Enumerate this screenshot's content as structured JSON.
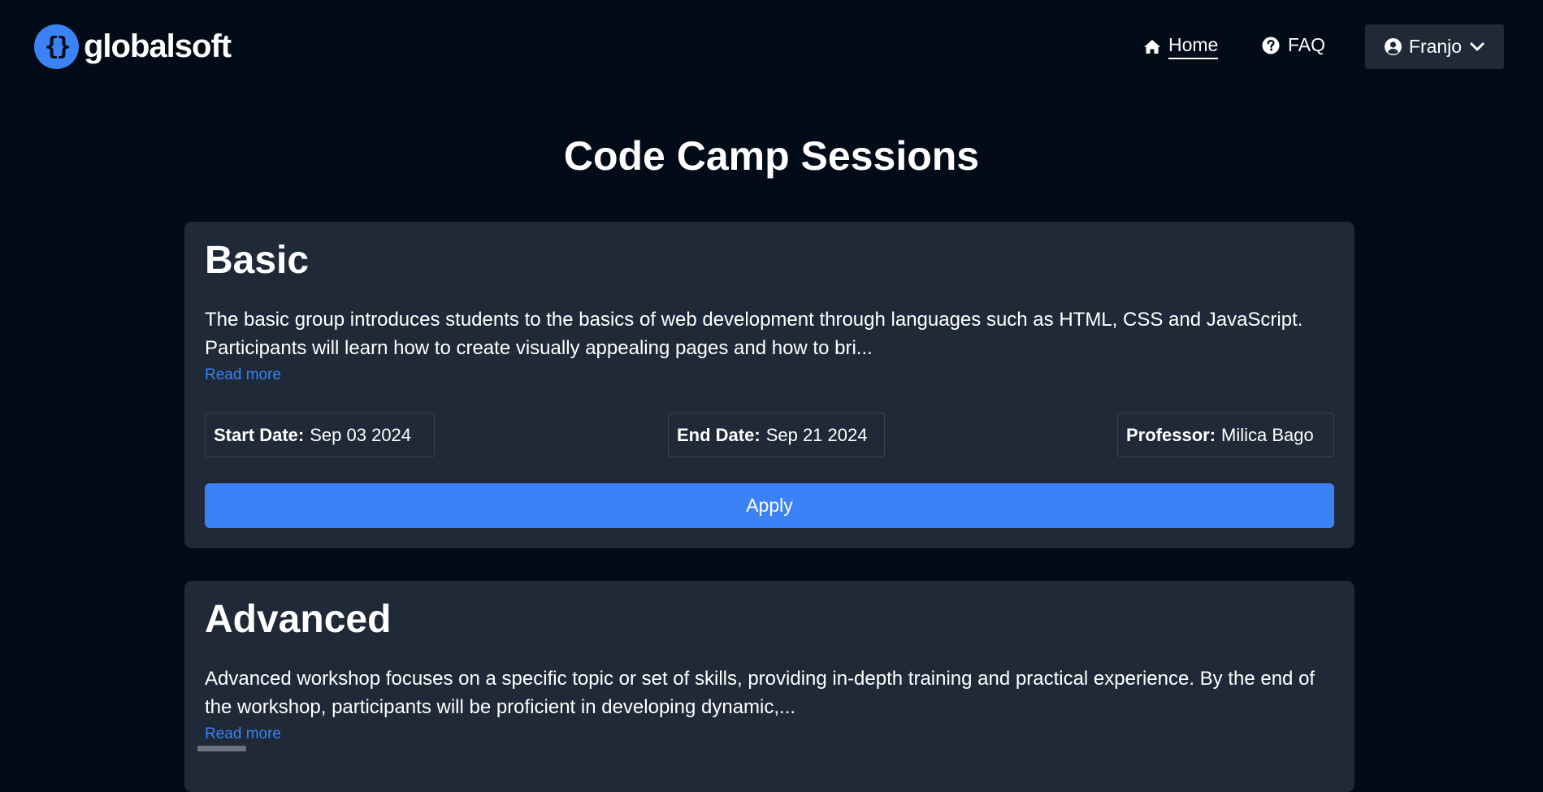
{
  "header": {
    "logo_mark": "{}",
    "logo_text": "globalsoft",
    "nav": {
      "home_label": "Home",
      "faq_label": "FAQ"
    },
    "user": {
      "name": "Franjo"
    }
  },
  "page": {
    "title": "Code Camp Sessions"
  },
  "sessions": [
    {
      "title": "Basic",
      "description": "The basic group introduces students to the basics of web development through languages such as HTML, CSS and JavaScript. Participants will learn how to create visually appealing pages and how to bri...",
      "read_more": "Read more",
      "start_label": "Start Date:",
      "start_value": "Sep 03 2024",
      "end_label": "End Date:",
      "end_value": "Sep 21 2024",
      "professor_label": "Professor:",
      "professor_value": "Milica Bago",
      "apply_label": "Apply"
    },
    {
      "title": "Advanced",
      "description": "Advanced workshop focuses on a specific topic or set of skills, providing in-depth training and practical experience. By the end of the workshop, participants will be proficient in developing dynamic,...",
      "read_more": "Read more"
    }
  ],
  "colors": {
    "background": "#020c18",
    "card": "#1f2937",
    "accent": "#3b82f6"
  },
  "icons": {
    "home": "home-icon",
    "faq": "question-circle-icon",
    "user": "user-circle-icon",
    "dropdown": "chevron-down-icon"
  }
}
